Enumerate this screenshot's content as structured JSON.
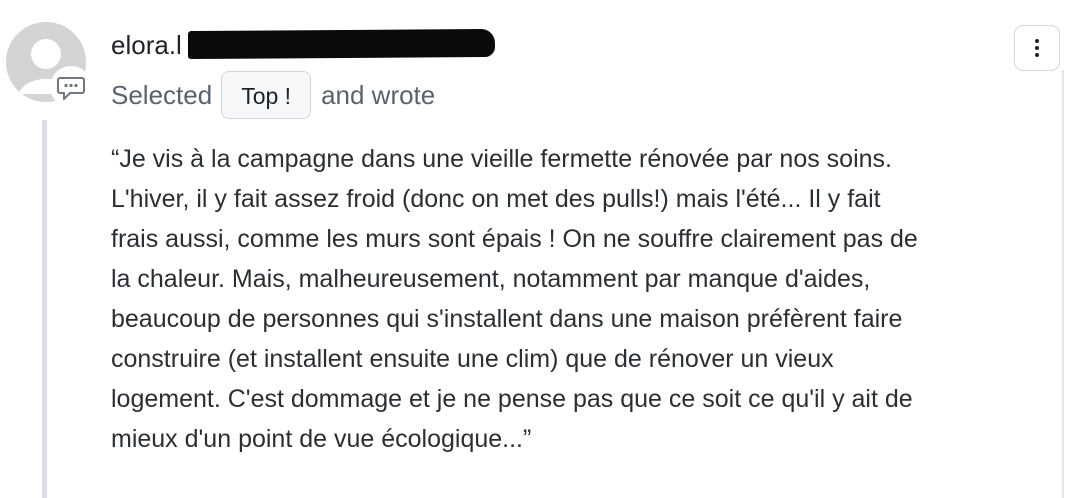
{
  "comment": {
    "username": "elora.l",
    "action_prefix": "Selected",
    "reaction_label": "Top !",
    "action_suffix": "and wrote",
    "text_lines": [
      "“Je vis à la campagne dans une vieille fermette rénovée par nos soins.",
      "L'hiver, il y fait assez froid (donc on met des pulls!) mais l'été... Il y fait",
      "frais aussi, comme les murs sont épais ! On ne souffre clairement pas de",
      "la chaleur. Mais, malheureusement, notamment par manque d'aides,",
      "beaucoup de personnes qui s'installent dans une maison préfèrent faire",
      "construire (et installent ensuite une clim) que de rénover un vieux",
      "logement. C'est dommage et je ne pense pas que ce soit ce qu'il y ait de",
      "mieux d'un point de vue écologique...”"
    ]
  },
  "icons": {
    "avatar": "default-user-avatar",
    "comment": "speech-bubble-ellipsis-icon",
    "menu": "vertical-ellipsis-icon"
  },
  "colors": {
    "avatar_bg": "#d7d7d7",
    "border": "#d0d7de",
    "pill_bg": "#f6f8fa",
    "muted_text": "#59636e"
  }
}
